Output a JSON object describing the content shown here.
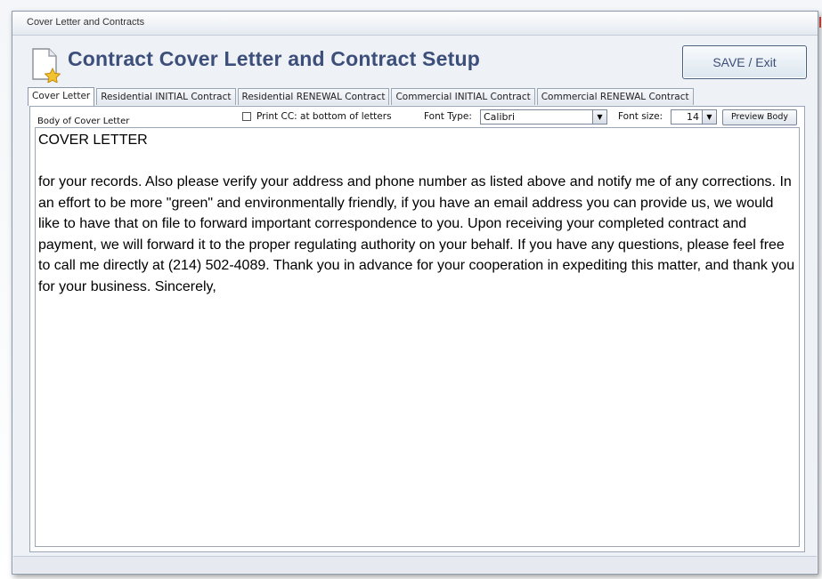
{
  "window": {
    "title": "Cover Letter and Contracts"
  },
  "header": {
    "icon": "document-star-icon",
    "title": "Contract Cover Letter and Contract Setup",
    "save_label": "SAVE / Exit"
  },
  "tabs": [
    {
      "label": "Cover Letter",
      "active": true
    },
    {
      "label": "Residential INITIAL Contract",
      "active": false
    },
    {
      "label": "Residential RENEWAL Contract",
      "active": false
    },
    {
      "label": "Commercial INITIAL Contract",
      "active": false
    },
    {
      "label": "Commercial RENEWAL Contract",
      "active": false
    }
  ],
  "panel": {
    "body_label": "Body of Cover Letter",
    "print_cc_label": "Print CC: at bottom of letters",
    "print_cc_checked": false,
    "font_type_label": "Font Type:",
    "font_type_value": "Calibri",
    "font_size_label": "Font size:",
    "font_size_value": "14",
    "preview_label": "Preview Body",
    "body_heading": "COVER LETTER",
    "body_paragraph": "for your records.  Also please verify your address and phone number as listed above and notify me of any corrections. In an effort to be more \"green\" and environmentally friendly, if you have an email address you can provide us, we would like to have that on file to forward important correspondence to you.  Upon receiving your completed contract and payment, we will forward it to the proper regulating authority on your behalf.  If you have any questions, please feel free to call me directly at (214) 502-4089.  Thank you in advance for your cooperation in expediting this matter, and thank you for your business.  Sincerely,"
  },
  "colors": {
    "title": "#3c4e7a",
    "window_bg": "#eef1f5",
    "border": "#9aa6b6"
  }
}
